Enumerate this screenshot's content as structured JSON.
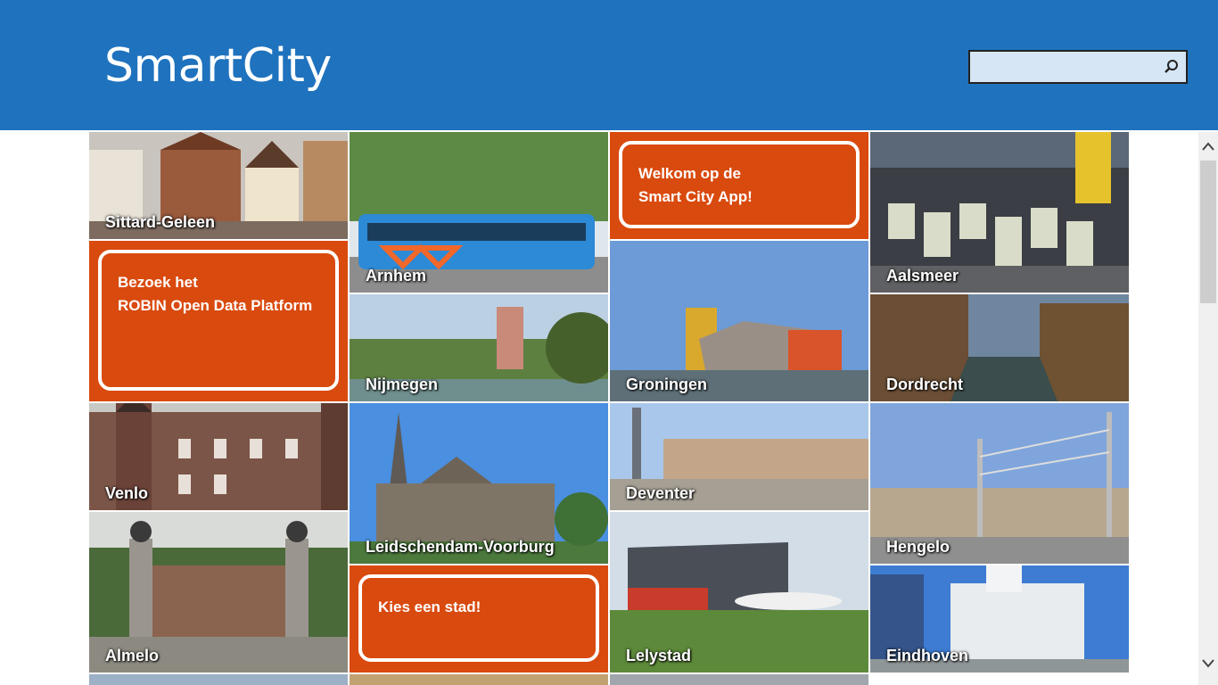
{
  "app": {
    "title": "SmartCity"
  },
  "search": {
    "value": "",
    "placeholder": ""
  },
  "promos": {
    "welcome": {
      "line1": "Welkom op de",
      "line2": "Smart City App!"
    },
    "robin": {
      "line1": "Bezoek het",
      "line2": "ROBIN Open Data Platform"
    },
    "choose": {
      "line1": "Kies een stad!"
    }
  },
  "cities": {
    "sittard": "Sittard-Geleen",
    "arnhem": "Arnhem",
    "aalsmeer": "Aalsmeer",
    "nijmegen": "Nijmegen",
    "groningen": "Groningen",
    "dordrecht": "Dordrecht",
    "venlo": "Venlo",
    "leidschendam": "Leidschendam-Voorburg",
    "deventer": "Deventer",
    "hengelo": "Hengelo",
    "almelo": "Almelo",
    "lelystad": "Lelystad",
    "eindhoven": "Eindhoven"
  },
  "colors": {
    "header": "#1f72bd",
    "promo": "#d94a0e"
  },
  "icons": {
    "search": "search-icon",
    "scroll_up": "chevron-up-icon",
    "scroll_down": "chevron-down-icon"
  }
}
